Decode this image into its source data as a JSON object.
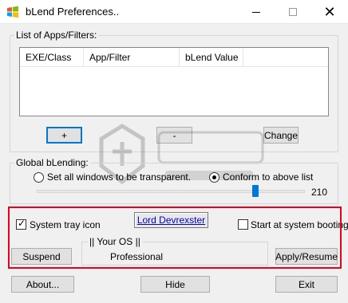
{
  "window": {
    "title": "bLend Preferences..",
    "minimize_glyph": "",
    "maximize_glyph": "",
    "close_glyph": "✕"
  },
  "apps_group": {
    "label": "List of Apps/Filters:",
    "columns": [
      "EXE/Class",
      "App/Filter",
      "bLend Value"
    ],
    "add_label": "+",
    "remove_label": "-",
    "change_label": "Change"
  },
  "global_group": {
    "label": "Global bLending:",
    "option_all": "Set all windows to be transparent.",
    "option_list": "Conform to above list",
    "selected_option": "option_list",
    "value_label": "210",
    "value": 210,
    "min": 0,
    "max": 255
  },
  "options": {
    "tray_icon_label": "System tray icon",
    "tray_icon_checked": true,
    "author_link": "Lord Devrexster",
    "boot_label": "Start at system booting.",
    "boot_checked": false,
    "suspend_label": "Suspend",
    "os_group_label": "|| Your OS ||",
    "os_value": "Professional",
    "apply_label": "Apply/Resume"
  },
  "footer": {
    "about_label": "About...",
    "hide_label": "Hide",
    "exit_label": "Exit"
  },
  "colors": {
    "highlight": "#e8001c",
    "accent": "#0078d7",
    "link": "#0000cc"
  }
}
